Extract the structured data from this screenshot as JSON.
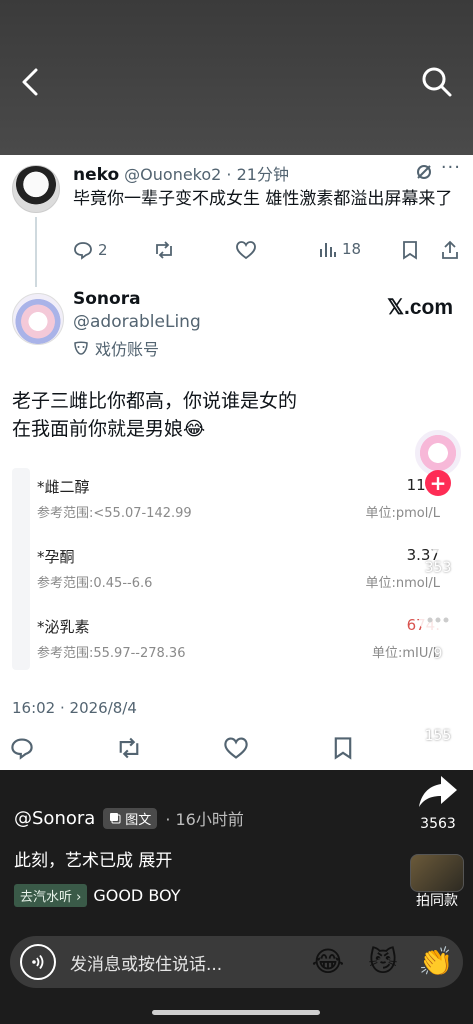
{
  "reply": {
    "name": "neko",
    "meta": "@Ouoneko2 · 21分钟",
    "text": "毕竟你一辈子变不成女生 雄性激素都溢出屏幕来了",
    "more": "···",
    "actions": {
      "replies": "2",
      "views": "18"
    }
  },
  "main": {
    "name": "Sonora",
    "handle": "@adorableLing",
    "parody": "戏仿账号",
    "xcom": "𝕏.com",
    "text": "老子三雌比你都高，你说谁是女的\n在我面前你就是男娘😂",
    "timestamp": "16:02 · 2026/8/4"
  },
  "lab_report": [
    {
      "name": "*雌二醇",
      "value": "117.",
      "ref": "参考范围:<55.07-142.99",
      "unit": "单位:pmol/L",
      "value_color": "#222222"
    },
    {
      "name": "*孕酮",
      "value": "3.37",
      "ref": "参考范围:0.45--6.6",
      "unit": "单位:nmol/L",
      "value_color": "#222222"
    },
    {
      "name": "*泌乳素",
      "value": "674.",
      "ref": "参考范围:55.97--278.36",
      "unit": "单位:mIU/L",
      "value_color": "#d9534f"
    }
  ],
  "right": {
    "follow": "+",
    "likes": "353",
    "comments": "9",
    "favorites": "155",
    "shares": "3563",
    "music_label": "拍同款"
  },
  "info": {
    "user": "@Sonora",
    "badge": "图文",
    "time": "· 16小时前",
    "desc": "此刻，艺术已成 展开",
    "tag_chip": "去汽水听 ›",
    "tag_song": "GOOD BOY"
  },
  "input": {
    "placeholder": "发消息或按住说话...",
    "emojis": [
      "😂",
      "😼",
      "👏"
    ]
  },
  "colors": {
    "accent": "#fe2c55",
    "twitter_gray": "#536471"
  }
}
